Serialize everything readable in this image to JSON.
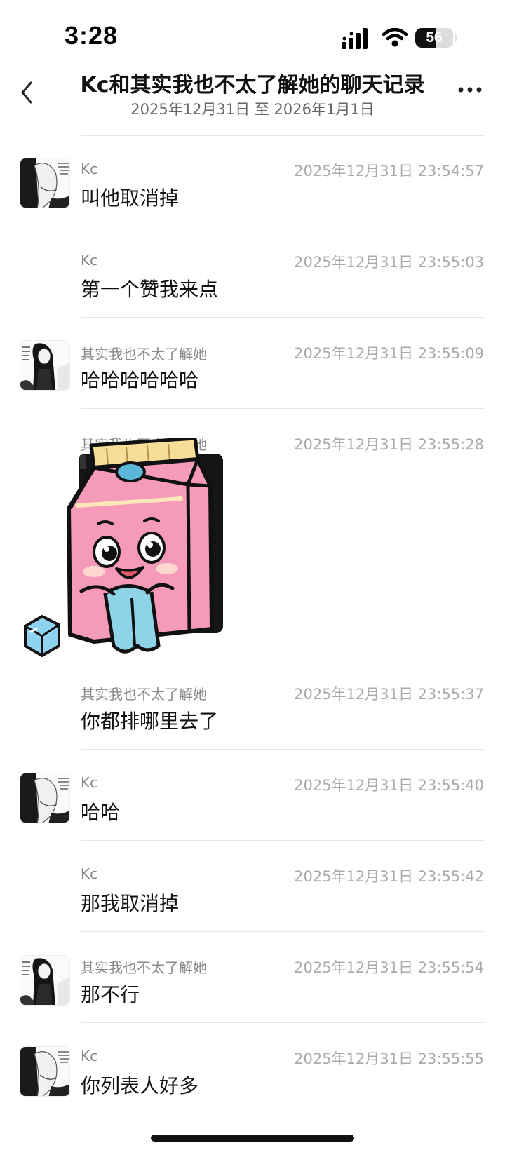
{
  "status": {
    "time": "3:28",
    "battery_level": "56",
    "battery_fraction": 0.56
  },
  "header": {
    "title": "Kc和其实我也不太了解她的聊天记录",
    "subtitle": "2025年12月31日 至 2026年1月1日",
    "back_icon": "chevron-left-icon",
    "more_icon": "more-horizontal-icon"
  },
  "messages": [
    {
      "sender": "Kc",
      "time": "2025年12月31日 23:54:57",
      "text": "叫他取消掉"
    },
    {
      "sender": "Kc",
      "time": "2025年12月31日 23:55:03",
      "text": "第一个赞我来点"
    },
    {
      "sender": "其实我也不太了解她",
      "time": "2025年12月31日 23:55:09",
      "text": "哈哈哈哈哈哈"
    },
    {
      "sender": "其实我也不太了解她",
      "time": "2025年12月31日 23:55:28",
      "text": "",
      "sticker": "milk-carton-sticker"
    },
    {
      "sender": "其实我也不太了解她",
      "time": "2025年12月31日 23:55:37",
      "text": "你都排哪里去了"
    },
    {
      "sender": "Kc",
      "time": "2025年12月31日 23:55:40",
      "text": "哈哈"
    },
    {
      "sender": "Kc",
      "time": "2025年12月31日 23:55:42",
      "text": "那我取消掉"
    },
    {
      "sender": "其实我也不太了解她",
      "time": "2025年12月31日 23:55:54",
      "text": "那不行"
    },
    {
      "sender": "Kc",
      "time": "2025年12月31日 23:55:55",
      "text": "你列表人好多"
    }
  ]
}
